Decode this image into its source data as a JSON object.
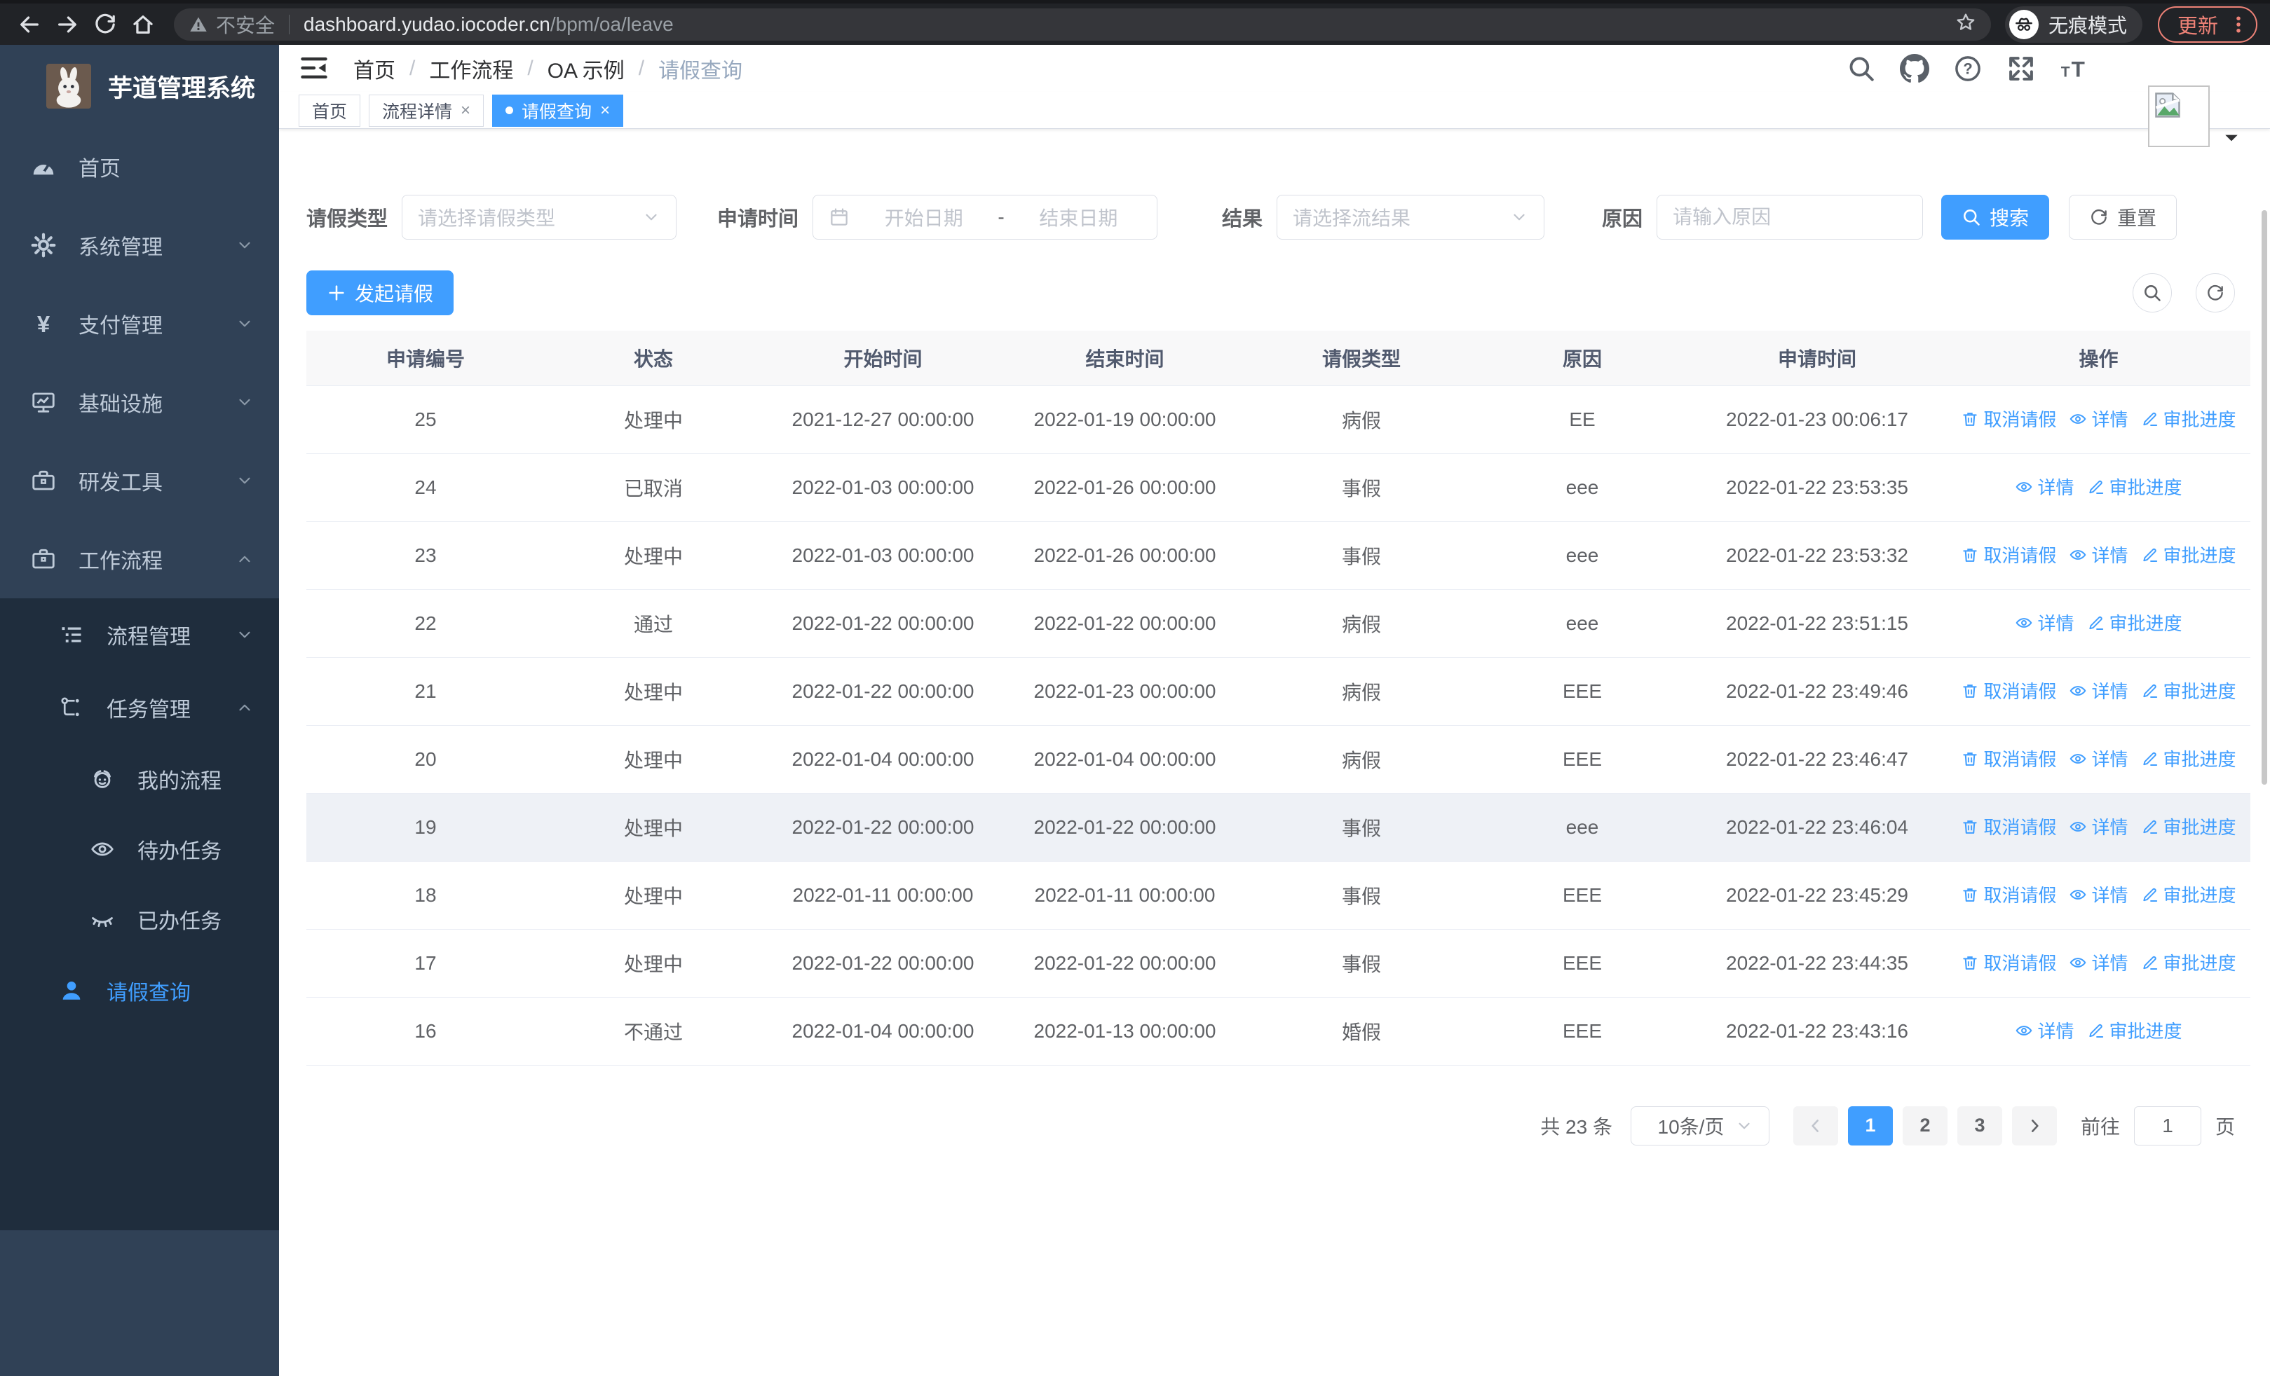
{
  "browser": {
    "security_label": "不安全",
    "url_host": "dashboard.yudao.iocoder.cn",
    "url_path": "/bpm/oa/leave",
    "incognito_label": "无痕模式",
    "update_label": "更新"
  },
  "sidebar": {
    "app_title": "芋道管理系统",
    "items": [
      {
        "label": "首页"
      },
      {
        "label": "系统管理"
      },
      {
        "label": "支付管理"
      },
      {
        "label": "基础设施"
      },
      {
        "label": "研发工具"
      },
      {
        "label": "工作流程"
      },
      {
        "label": "流程管理"
      },
      {
        "label": "任务管理"
      },
      {
        "label": "我的流程"
      },
      {
        "label": "待办任务"
      },
      {
        "label": "已办任务"
      },
      {
        "label": "请假查询"
      }
    ]
  },
  "breadcrumb": {
    "separator": "/",
    "items": [
      {
        "label": "首页"
      },
      {
        "label": "工作流程"
      },
      {
        "label": "OA 示例"
      },
      {
        "label": "请假查询"
      }
    ]
  },
  "tabs": {
    "close_glyph": "×",
    "items": [
      {
        "label": "首页"
      },
      {
        "label": "流程详情"
      },
      {
        "label": "请假查询"
      }
    ]
  },
  "filters": {
    "leave_type_label": "请假类型",
    "leave_type_placeholder": "请选择请假类型",
    "apply_time_label": "申请时间",
    "start_placeholder": "开始日期",
    "range_separator": "-",
    "end_placeholder": "结束日期",
    "result_label": "结果",
    "result_placeholder": "请选择流结果",
    "reason_label": "原因",
    "reason_placeholder": "请输入原因",
    "search_label": "搜索",
    "reset_label": "重置"
  },
  "toolbar": {
    "create_label": "发起请假"
  },
  "table": {
    "columns": [
      "申请编号",
      "状态",
      "开始时间",
      "结束时间",
      "请假类型",
      "原因",
      "申请时间",
      "操作"
    ],
    "action_labels": {
      "cancel": "取消请假",
      "detail": "详情",
      "progress": "审批进度"
    },
    "rows": [
      {
        "id": "25",
        "status": "处理中",
        "start": "2021-12-27 00:00:00",
        "end": "2022-01-19 00:00:00",
        "type": "病假",
        "reason": "EE",
        "apply": "2022-01-23 00:06:17",
        "actions": [
          "cancel",
          "detail",
          "progress"
        ]
      },
      {
        "id": "24",
        "status": "已取消",
        "start": "2022-01-03 00:00:00",
        "end": "2022-01-26 00:00:00",
        "type": "事假",
        "reason": "eee",
        "apply": "2022-01-22 23:53:35",
        "actions": [
          "detail",
          "progress"
        ]
      },
      {
        "id": "23",
        "status": "处理中",
        "start": "2022-01-03 00:00:00",
        "end": "2022-01-26 00:00:00",
        "type": "事假",
        "reason": "eee",
        "apply": "2022-01-22 23:53:32",
        "actions": [
          "cancel",
          "detail",
          "progress"
        ]
      },
      {
        "id": "22",
        "status": "通过",
        "start": "2022-01-22 00:00:00",
        "end": "2022-01-22 00:00:00",
        "type": "病假",
        "reason": "eee",
        "apply": "2022-01-22 23:51:15",
        "actions": [
          "detail",
          "progress"
        ]
      },
      {
        "id": "21",
        "status": "处理中",
        "start": "2022-01-22 00:00:00",
        "end": "2022-01-23 00:00:00",
        "type": "病假",
        "reason": "EEE",
        "apply": "2022-01-22 23:49:46",
        "actions": [
          "cancel",
          "detail",
          "progress"
        ]
      },
      {
        "id": "20",
        "status": "处理中",
        "start": "2022-01-04 00:00:00",
        "end": "2022-01-04 00:00:00",
        "type": "病假",
        "reason": "EEE",
        "apply": "2022-01-22 23:46:47",
        "actions": [
          "cancel",
          "detail",
          "progress"
        ]
      },
      {
        "id": "19",
        "status": "处理中",
        "start": "2022-01-22 00:00:00",
        "end": "2022-01-22 00:00:00",
        "type": "事假",
        "reason": "eee",
        "apply": "2022-01-22 23:46:04",
        "actions": [
          "cancel",
          "detail",
          "progress"
        ],
        "highlighted": true
      },
      {
        "id": "18",
        "status": "处理中",
        "start": "2022-01-11 00:00:00",
        "end": "2022-01-11 00:00:00",
        "type": "事假",
        "reason": "EEE",
        "apply": "2022-01-22 23:45:29",
        "actions": [
          "cancel",
          "detail",
          "progress"
        ]
      },
      {
        "id": "17",
        "status": "处理中",
        "start": "2022-01-22 00:00:00",
        "end": "2022-01-22 00:00:00",
        "type": "事假",
        "reason": "EEE",
        "apply": "2022-01-22 23:44:35",
        "actions": [
          "cancel",
          "detail",
          "progress"
        ]
      },
      {
        "id": "16",
        "status": "不通过",
        "start": "2022-01-04 00:00:00",
        "end": "2022-01-13 00:00:00",
        "type": "婚假",
        "reason": "EEE",
        "apply": "2022-01-22 23:43:16",
        "actions": [
          "detail",
          "progress"
        ]
      }
    ]
  },
  "pagination": {
    "total_label": "共 23 条",
    "page_size_label": "10条/页",
    "pages": [
      {
        "label": "1",
        "active": true
      },
      {
        "label": "2"
      },
      {
        "label": "3"
      }
    ],
    "goto_label": "前往",
    "goto_value": "1",
    "page_suffix": "页"
  },
  "colors": {
    "accent": "#409eff",
    "sidebar_bg": "#304156",
    "submenu_bg": "#1f2d3d",
    "chrome_bg": "#212327",
    "update_red": "#ee8277",
    "row_highlight": "#eef1f6"
  }
}
